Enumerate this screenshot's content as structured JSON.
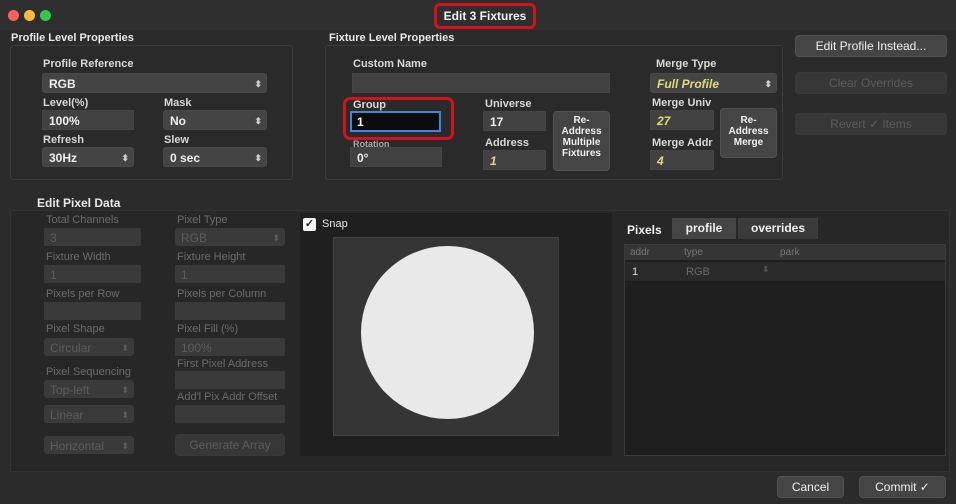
{
  "window": {
    "title": "Edit 3 Fixtures",
    "traffic_colors": {
      "close": "#fc605c",
      "minimize": "#fcbb40",
      "zoom": "#34c84a"
    }
  },
  "profile_level": {
    "title": "Profile Level Properties",
    "profile_reference": {
      "label": "Profile Reference",
      "value": "RGB"
    },
    "level": {
      "label": "Level(%)",
      "value": "100%"
    },
    "mask": {
      "label": "Mask",
      "value": "No"
    },
    "refresh": {
      "label": "Refresh",
      "value": "30Hz"
    },
    "slew": {
      "label": "Slew",
      "value": "0 sec"
    }
  },
  "fixture_level": {
    "title": "Fixture Level Properties",
    "custom_name": {
      "label": "Custom Name",
      "value": ""
    },
    "group": {
      "label": "Group",
      "value": "1"
    },
    "rotation": {
      "label": "Rotation",
      "value": "0°"
    },
    "universe": {
      "label": "Universe",
      "value": "17"
    },
    "address": {
      "label": "Address",
      "value": "1"
    },
    "readdress_multiple": [
      "Re-",
      "Address",
      "Multiple",
      "Fixtures"
    ],
    "merge_type": {
      "label": "Merge Type",
      "value": "Full Profile"
    },
    "merge_univ": {
      "label": "Merge Univ",
      "value": "27"
    },
    "merge_addr": {
      "label": "Merge Addr",
      "value": "4"
    },
    "readdress_merge": [
      "Re-",
      "Address",
      "Merge"
    ]
  },
  "side_buttons": {
    "edit_profile": "Edit Profile Instead...",
    "clear_overrides": "Clear Overrides",
    "revert_items": "Revert ✓ Items"
  },
  "pixel_data": {
    "title": "Edit Pixel Data",
    "total_channels": {
      "label": "Total Channels",
      "value": "3"
    },
    "pixel_type": {
      "label": "Pixel Type",
      "value": "RGB"
    },
    "fixture_width": {
      "label": "Fixture Width",
      "value": "1"
    },
    "fixture_height": {
      "label": "Fixture Height",
      "value": "1"
    },
    "pixels_per_row": {
      "label": "Pixels per Row",
      "value": ""
    },
    "pixels_per_column": {
      "label": "Pixels per Column",
      "value": ""
    },
    "pixel_shape": {
      "label": "Pixel Shape",
      "value": "Circular"
    },
    "pixel_fill": {
      "label": "Pixel Fill (%)",
      "value": "100%"
    },
    "pixel_sequencing": {
      "label": "Pixel Sequencing",
      "value": "Top-left"
    },
    "first_pixel_address": {
      "label": "First Pixel Address",
      "value": ""
    },
    "sequencing_mode": "Linear",
    "addl_pix_offset": {
      "label": "Add'l Pix Addr Offset",
      "value": ""
    },
    "direction": "Horizontal",
    "generate_array": "Generate Array"
  },
  "preview": {
    "snap_label": "Snap",
    "snap_checked": true,
    "check_mark": "✓"
  },
  "pixels_table": {
    "label": "Pixels",
    "tabs": [
      "profile",
      "overrides"
    ],
    "columns": [
      "addr",
      "type",
      "park"
    ],
    "rows": [
      {
        "addr": "1",
        "type": "RGB",
        "park": ""
      }
    ]
  },
  "footer": {
    "cancel": "Cancel",
    "commit": "Commit ✓"
  }
}
